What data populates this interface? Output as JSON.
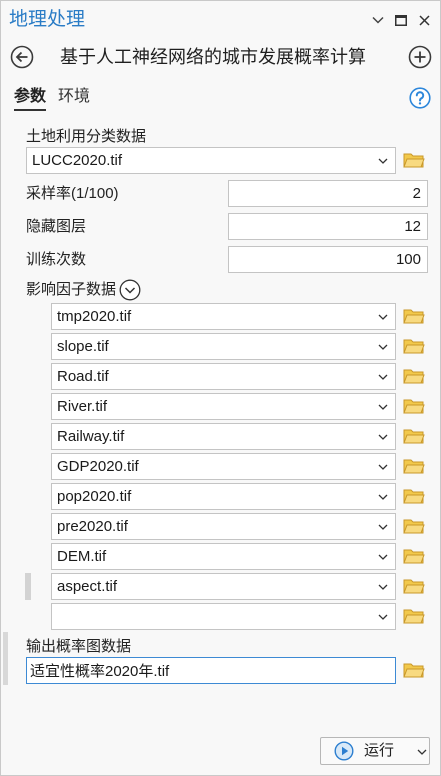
{
  "window": {
    "title": "地理处理",
    "icons": {
      "options": "chevron-down-icon",
      "maximize": "maximize-icon",
      "close": "close-icon"
    }
  },
  "tool": {
    "title": "基于人工神经网络的城市发展概率计算",
    "icons": {
      "back": "back-arrow-icon",
      "add": "add-circle-icon",
      "help": "help-icon"
    }
  },
  "tabs": [
    {
      "label": "参数",
      "active": true
    },
    {
      "label": "环境",
      "active": false
    }
  ],
  "parameters": {
    "land_use": {
      "label": "土地利用分类数据",
      "value": "LUCC2020.tif"
    },
    "sampling_rate": {
      "label": "采样率(1/100)",
      "value": "2"
    },
    "hidden_layers": {
      "label": "隐藏图层",
      "value": "12"
    },
    "training_epochs": {
      "label": "训练次数",
      "value": "100"
    },
    "factors": {
      "label": "影响因子数据",
      "expanded": true,
      "items": [
        "tmp2020.tif",
        "slope.tif",
        "Road.tif",
        "River.tif",
        "Railway.tif",
        "GDP2020.tif",
        "pop2020.tif",
        "pre2020.tif",
        "DEM.tif",
        "aspect.tif",
        ""
      ]
    },
    "output": {
      "label": "输出概率图数据",
      "value": "适宜性概率2020年.tif"
    }
  },
  "run_button": {
    "label": "运行",
    "icon": "run-play-icon"
  },
  "colors": {
    "accent": "#2a7cc6",
    "focus_border": "#3d8ad4",
    "folder": "#f2c94c",
    "help": "#2d87db"
  }
}
